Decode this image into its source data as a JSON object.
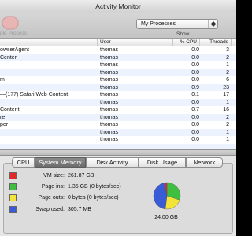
{
  "window": {
    "title": "Activity Monitor"
  },
  "toolbar": {
    "quit_label": "ple Process",
    "filter_selected": "My Processes",
    "show_label": "Show"
  },
  "table": {
    "columns": {
      "name": "",
      "user": "User",
      "cpu": "% CPU",
      "threads": "Threads"
    },
    "rows": [
      {
        "name": "owserAgent",
        "user": "thomas",
        "cpu": "0.0",
        "threads": "3"
      },
      {
        "name": "Center",
        "user": "thomas",
        "cpu": "0.0",
        "threads": "2"
      },
      {
        "name": "",
        "user": "thomas",
        "cpu": "0.0",
        "threads": "1"
      },
      {
        "name": "",
        "user": "thomas",
        "cpu": "0.0",
        "threads": "2"
      },
      {
        "name": "m",
        "user": "thomas",
        "cpu": "0.0",
        "threads": "6"
      },
      {
        "name": "",
        "user": "thomas",
        "cpu": "0.9",
        "threads": "23"
      },
      {
        "name": "—(177) Safari Web Content",
        "user": "thomas",
        "cpu": "0.1",
        "threads": "17"
      },
      {
        "name": "",
        "user": "thomas",
        "cpu": "0.0",
        "threads": "1"
      },
      {
        "name": "Content",
        "user": "thomas",
        "cpu": "0.7",
        "threads": "16"
      },
      {
        "name": "re",
        "user": "thomas",
        "cpu": "0.0",
        "threads": "2"
      },
      {
        "name": "per",
        "user": "thomas",
        "cpu": "0.0",
        "threads": "2"
      },
      {
        "name": "",
        "user": "thomas",
        "cpu": "0.0",
        "threads": "1"
      },
      {
        "name": "",
        "user": "thomas",
        "cpu": "0.0",
        "threads": "1"
      },
      {
        "name": "",
        "user": "",
        "cpu": "",
        "threads": ""
      }
    ]
  },
  "tabs": [
    {
      "label": "CPU",
      "active": false
    },
    {
      "label": "System Memory",
      "active": true
    },
    {
      "label": "Disk Activity",
      "active": false
    },
    {
      "label": "Disk Usage",
      "active": false
    },
    {
      "label": "Network",
      "active": false
    }
  ],
  "memory": {
    "stats": [
      {
        "label": "VM size:",
        "value": "261.87 GB",
        "color": "#e8262a"
      },
      {
        "label": "Page ins:",
        "value": "1.35 GB (0 bytes/sec)",
        "color": "#3fbf3f"
      },
      {
        "label": "Page outs:",
        "value": "0 bytes (0 bytes/sec)",
        "color": "#f3e43a"
      },
      {
        "label": "Swap used:",
        "value": "305.7 MB",
        "color": "#3a5bd6"
      }
    ],
    "total": "24.00 GB",
    "pie_fractions": {
      "green": 0.3,
      "yellow": 0.22,
      "blue": 0.45,
      "red": 0.03
    }
  }
}
